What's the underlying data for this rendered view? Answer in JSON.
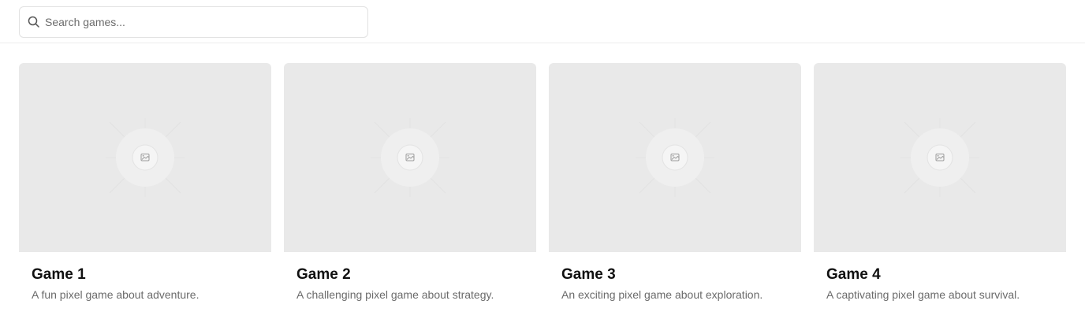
{
  "search": {
    "placeholder": "Search games...",
    "value": "",
    "icon": "search-icon"
  },
  "games": [
    {
      "title": "Game 1",
      "description": "A fun pixel game about adventure.",
      "image_icon": "image-placeholder-icon"
    },
    {
      "title": "Game 2",
      "description": "A challenging pixel game about strategy.",
      "image_icon": "image-placeholder-icon"
    },
    {
      "title": "Game 3",
      "description": "An exciting pixel game about exploration.",
      "image_icon": "image-placeholder-icon"
    },
    {
      "title": "Game 4",
      "description": "A captivating pixel game about survival.",
      "image_icon": "image-placeholder-icon"
    }
  ],
  "colors": {
    "placeholder_bg": "#e9e9e9",
    "title": "#111111",
    "description": "#6b6b6b",
    "border": "#e2e2e2"
  }
}
